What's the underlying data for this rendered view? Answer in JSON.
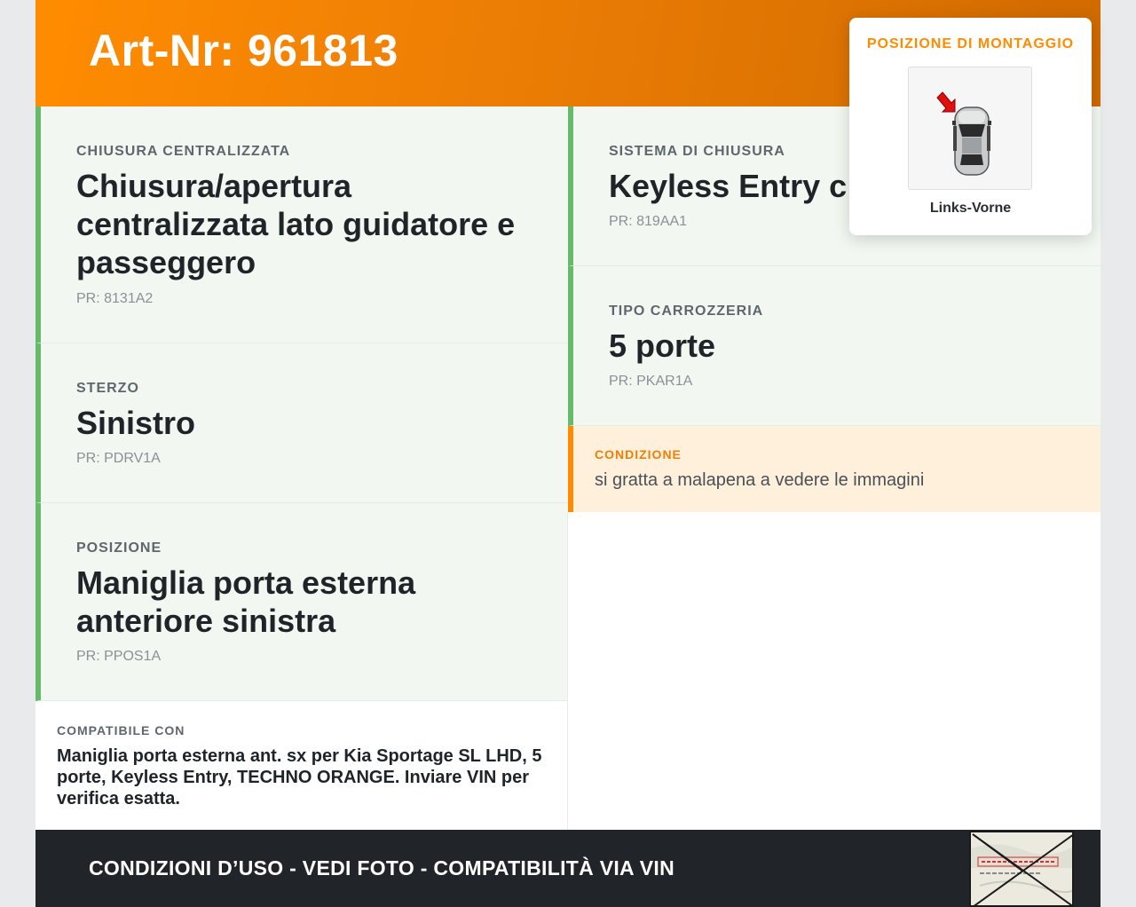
{
  "header": {
    "title": "Art-Nr: 961813"
  },
  "cards": {
    "central_locking": {
      "label": "CHIUSURA CENTRALIZZATA",
      "value": "Chiusura/apertura centralizzata lato guidatore e passeggero",
      "code": "PR: 8131A2"
    },
    "steering": {
      "label": "STERZO",
      "value": "Sinistro",
      "code": "PR: PDRV1A"
    },
    "position": {
      "label": "POSIZIONE",
      "value": "Maniglia porta esterna anteriore sinistra",
      "code": "PR: PPOS1A"
    },
    "locking_system": {
      "label": "SISTEMA DI CHIUSURA",
      "value": "Keyless Entry c",
      "code": "PR: 819AA1"
    },
    "body_type": {
      "label": "TIPO CARROZZERIA",
      "value": "5 porte",
      "code": "PR: PKAR1A"
    }
  },
  "condition": {
    "label": "CONDIZIONE",
    "text": "si gratta a malapena a vedere le immagini"
  },
  "compat": {
    "label": "COMPATIBILE CON",
    "text": "Maniglia porta esterna ant. sx per Kia Sportage SL LHD, 5 porte, Keyless Entry, TECHNO ORANGE. Inviare VIN per verifica esatta."
  },
  "footer": {
    "text": "CONDIZIONI D’USO - VEDI FOTO - COMPATIBILITÀ VIA VIN"
  },
  "mount": {
    "label": "POSIZIONE DI MONTAGGIO",
    "caption": "Links-Vorne"
  },
  "colors": {
    "accent": "#ff8c00",
    "card_border": "#66bb6a",
    "card_bg": "#f2f8f1",
    "condition_bg": "#fff0dc",
    "footer_bg": "#212428"
  },
  "icons": {
    "car": "car-top-view-icon",
    "arrow": "red-arrow-icon",
    "stamp": "document-stamp-icon"
  }
}
